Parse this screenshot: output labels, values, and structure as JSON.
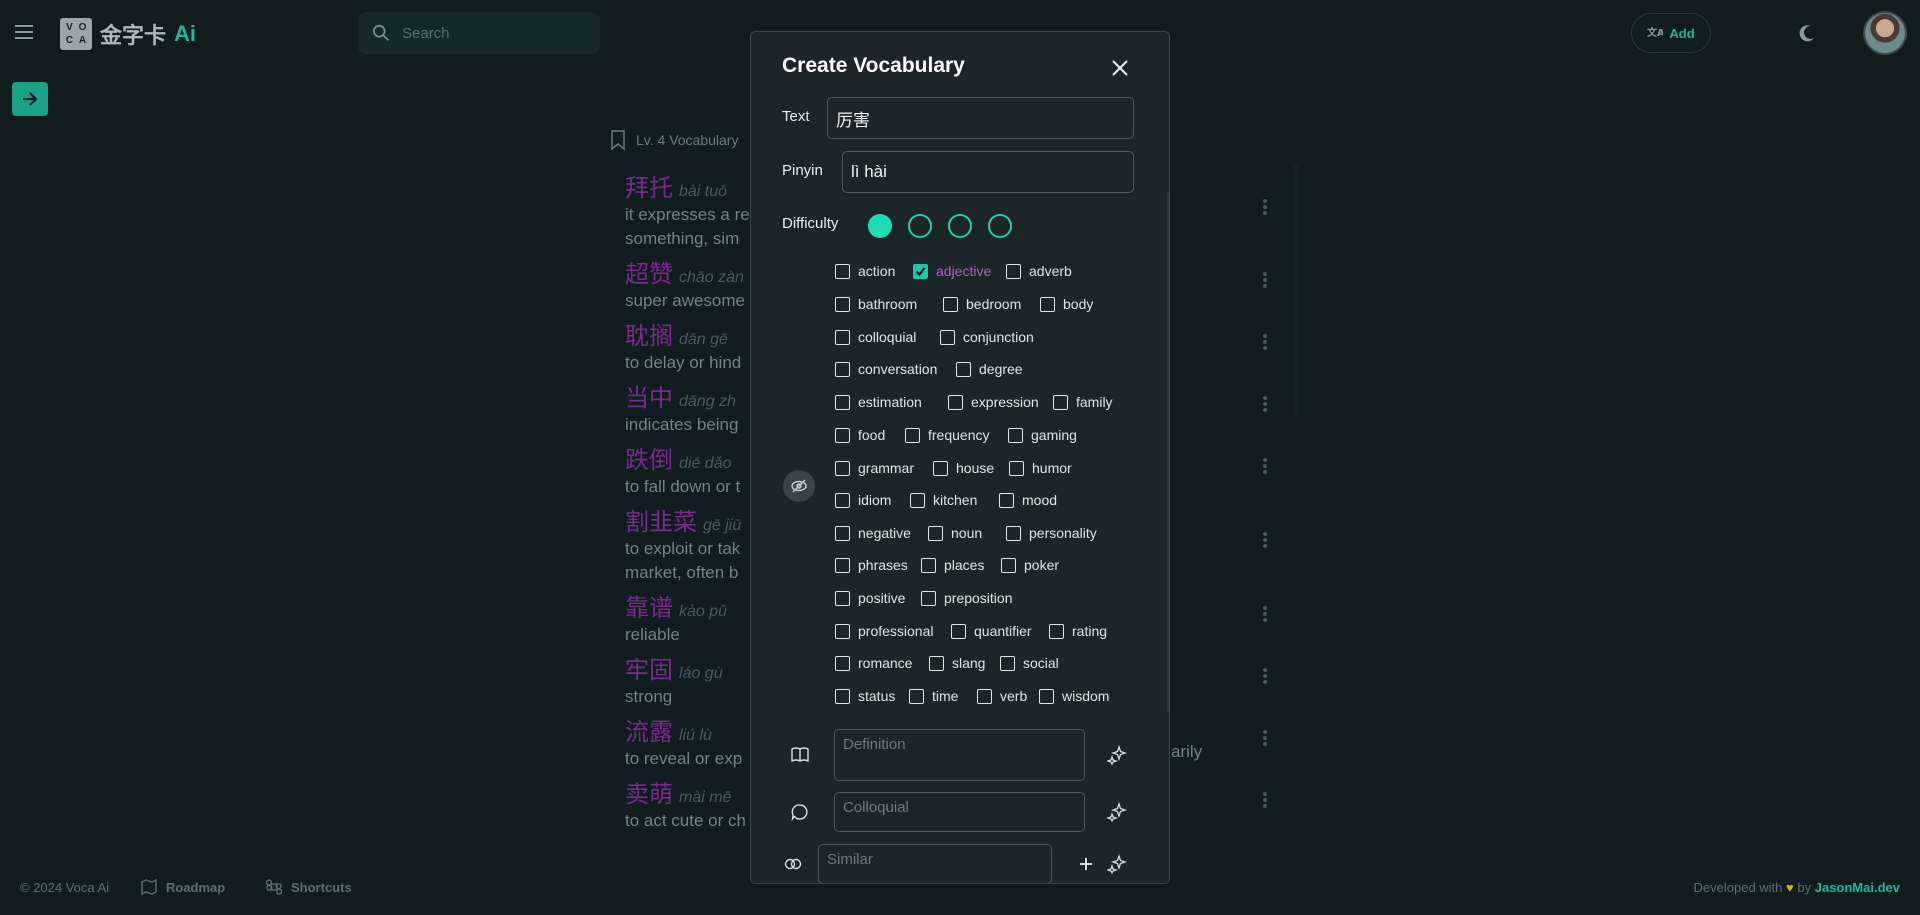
{
  "app": {
    "logo_letters": [
      "V",
      "O",
      "C",
      "A"
    ],
    "title_cn": "金字卡",
    "title_ai": "Ai",
    "search_placeholder": "Search",
    "add_label": "Add",
    "accent_color": "#1eb99b"
  },
  "list": {
    "header": "Lv. 4 Vocabulary",
    "items": [
      {
        "word": "拜托",
        "pinyin": "bài tuō",
        "def": "it expresses a re",
        "def2": "something, sim"
      },
      {
        "word": "超赞",
        "pinyin": "chāo zàn",
        "def": "super awesome"
      },
      {
        "word": "耽搁",
        "pinyin": "dān gē",
        "def": "to delay or hind"
      },
      {
        "word": "当中",
        "pinyin": "dāng zh",
        "def": "indicates being"
      },
      {
        "word": "跌倒",
        "pinyin": "diē dǎo",
        "def": "to fall down or t"
      },
      {
        "word": "割韭菜",
        "pinyin": "gē jiū",
        "def": "to exploit or tak",
        "def2": "market, often b"
      },
      {
        "word": "靠谱",
        "pinyin": "kào pǔ",
        "def": "reliable"
      },
      {
        "word": "牢固",
        "pinyin": "láo gù",
        "def": "strong"
      },
      {
        "word": "流露",
        "pinyin": "liú lù",
        "def": "to reveal or exp",
        "def_tail": "arily"
      },
      {
        "word": "卖萌",
        "pinyin": "mài mē",
        "def": "to act cute or ch"
      }
    ]
  },
  "footer": {
    "copyright": "© 2024 Voca Ai",
    "roadmap": "Roadmap",
    "shortcuts": "Shortcuts",
    "dev_prefix": "Developed with",
    "dev_by": "by",
    "dev_name": "JasonMai.dev"
  },
  "modal": {
    "title": "Create Vocabulary",
    "text_label": "Text",
    "text_value": "厉害",
    "pinyin_label": "Pinyin",
    "pinyin_value": "lì hài",
    "difficulty_label": "Difficulty",
    "difficulty_level": 1,
    "difficulty_max": 4,
    "tag_rows": [
      [
        {
          "label": "action",
          "checked": false
        },
        {
          "label": "adjective",
          "checked": true
        },
        {
          "label": "adverb",
          "checked": false
        }
      ],
      [
        {
          "label": "bathroom",
          "checked": false
        },
        {
          "label": "bedroom",
          "checked": false
        },
        {
          "label": "body",
          "checked": false
        }
      ],
      [
        {
          "label": "colloquial",
          "checked": false
        },
        {
          "label": "conjunction",
          "checked": false
        }
      ],
      [
        {
          "label": "conversation",
          "checked": false
        },
        {
          "label": "degree",
          "checked": false
        }
      ],
      [
        {
          "label": "estimation",
          "checked": false
        },
        {
          "label": "expression",
          "checked": false
        },
        {
          "label": "family",
          "checked": false
        }
      ],
      [
        {
          "label": "food",
          "checked": false
        },
        {
          "label": "frequency",
          "checked": false
        },
        {
          "label": "gaming",
          "checked": false
        }
      ],
      [
        {
          "label": "grammar",
          "checked": false
        },
        {
          "label": "house",
          "checked": false
        },
        {
          "label": "humor",
          "checked": false
        }
      ],
      [
        {
          "label": "idiom",
          "checked": false
        },
        {
          "label": "kitchen",
          "checked": false
        },
        {
          "label": "mood",
          "checked": false
        }
      ],
      [
        {
          "label": "negative",
          "checked": false
        },
        {
          "label": "noun",
          "checked": false
        },
        {
          "label": "personality",
          "checked": false
        }
      ],
      [
        {
          "label": "phrases",
          "checked": false
        },
        {
          "label": "places",
          "checked": false
        },
        {
          "label": "poker",
          "checked": false
        }
      ],
      [
        {
          "label": "positive",
          "checked": false
        },
        {
          "label": "preposition",
          "checked": false
        }
      ],
      [
        {
          "label": "professional",
          "checked": false
        },
        {
          "label": "quantifier",
          "checked": false
        },
        {
          "label": "rating",
          "checked": false
        }
      ],
      [
        {
          "label": "romance",
          "checked": false
        },
        {
          "label": "slang",
          "checked": false
        },
        {
          "label": "social",
          "checked": false
        }
      ],
      [
        {
          "label": "status",
          "checked": false
        },
        {
          "label": "time",
          "checked": false
        },
        {
          "label": "verb",
          "checked": false
        },
        {
          "label": "wisdom",
          "checked": false
        }
      ]
    ],
    "definition_placeholder": "Definition",
    "colloquial_placeholder": "Colloquial",
    "similar_placeholder": "Similar"
  }
}
